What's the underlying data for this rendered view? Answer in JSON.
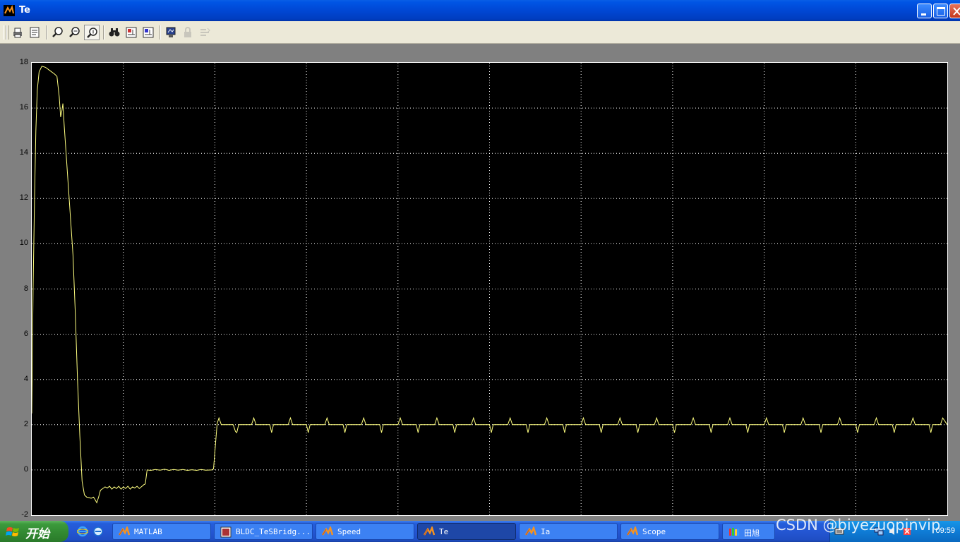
{
  "window": {
    "title": "Te"
  },
  "toolbar": {
    "buttons": [
      {
        "name": "print-button",
        "icon": "printer-icon"
      },
      {
        "name": "parameters-button",
        "icon": "parameters-icon"
      },
      {
        "name": "zoom-button",
        "icon": "magnifier-icon"
      },
      {
        "name": "zoom-x-button",
        "icon": "magnifier-x-icon"
      },
      {
        "name": "zoom-y-button",
        "icon": "magnifier-y-icon",
        "pressed": true
      },
      {
        "name": "autoscale-button",
        "icon": "binoculars-icon"
      },
      {
        "name": "save-axes-button",
        "icon": "save-axes-icon"
      },
      {
        "name": "restore-axes-button",
        "icon": "restore-axes-icon"
      },
      {
        "name": "floating-scope-button",
        "icon": "scope-icon"
      },
      {
        "name": "lock-axes-button",
        "icon": "lock-icon",
        "disabled": true
      },
      {
        "name": "signal-selection-button",
        "icon": "signal-selection-icon",
        "disabled": true
      }
    ]
  },
  "chart_data": {
    "type": "line",
    "title": "",
    "xlabel": "",
    "ylabel": "",
    "ylim": [
      -2,
      18
    ],
    "yticks": [
      "18",
      "16",
      "14",
      "12",
      "10",
      "8",
      "6",
      "4",
      "2",
      "0",
      "-2"
    ],
    "xlim": [
      0,
      0.2
    ],
    "grid": true,
    "line_color": "#ffff80",
    "background": "#000000",
    "series": [
      {
        "points": [
          [
            0,
            2.5
          ],
          [
            0.0003,
            8
          ],
          [
            0.0006,
            12
          ],
          [
            0.0009,
            15
          ],
          [
            0.0012,
            16.8
          ],
          [
            0.0016,
            17.6
          ],
          [
            0.0022,
            17.85
          ],
          [
            0.003,
            17.8
          ],
          [
            0.004,
            17.65
          ],
          [
            0.005,
            17.5
          ],
          [
            0.0055,
            17.4
          ],
          [
            0.006,
            16.5
          ],
          [
            0.0063,
            15.6
          ],
          [
            0.0066,
            15.9
          ],
          [
            0.0068,
            16.2
          ],
          [
            0.0071,
            15.2
          ],
          [
            0.008,
            12.5
          ],
          [
            0.009,
            9.5
          ],
          [
            0.0095,
            7
          ],
          [
            0.01,
            4
          ],
          [
            0.0105,
            1.5
          ],
          [
            0.011,
            -0.5
          ],
          [
            0.0115,
            -1.1
          ],
          [
            0.012,
            -1.2
          ],
          [
            0.013,
            -1.25
          ],
          [
            0.0135,
            -1.2
          ],
          [
            0.0138,
            -1.3
          ],
          [
            0.0142,
            -1.45
          ],
          [
            0.0146,
            -1.2
          ],
          [
            0.015,
            -0.9
          ],
          [
            0.016,
            -0.75
          ],
          [
            0.0165,
            -0.8
          ],
          [
            0.017,
            -0.72
          ],
          [
            0.0175,
            -0.85
          ],
          [
            0.018,
            -0.75
          ],
          [
            0.0185,
            -0.82
          ],
          [
            0.019,
            -0.72
          ],
          [
            0.0195,
            -0.85
          ],
          [
            0.02,
            -0.75
          ],
          [
            0.0205,
            -0.82
          ],
          [
            0.021,
            -0.72
          ],
          [
            0.0215,
            -0.85
          ],
          [
            0.022,
            -0.75
          ],
          [
            0.0225,
            -0.8
          ],
          [
            0.023,
            -0.72
          ],
          [
            0.0235,
            -0.82
          ],
          [
            0.0245,
            -0.65
          ],
          [
            0.0248,
            -0.62
          ],
          [
            0.0252,
            0
          ],
          [
            0.026,
            -0.02
          ],
          [
            0.027,
            0.02
          ],
          [
            0.028,
            -0.01
          ],
          [
            0.029,
            0.03
          ],
          [
            0.03,
            -0.02
          ],
          [
            0.031,
            0.02
          ],
          [
            0.032,
            -0.01
          ],
          [
            0.033,
            0.02
          ],
          [
            0.034,
            -0.02
          ],
          [
            0.035,
            0.01
          ],
          [
            0.036,
            -0.02
          ],
          [
            0.037,
            0.02
          ],
          [
            0.038,
            -0.01
          ],
          [
            0.0393,
            0
          ],
          [
            0.0397,
            0.05
          ],
          [
            0.0405,
            2.05
          ],
          [
            0.0409,
            2.3
          ],
          [
            0.0414,
            2.0
          ],
          [
            0.044,
            2.0
          ],
          [
            0.0445,
            1.7
          ],
          [
            0.0448,
            1.65
          ],
          [
            0.0452,
            2.0
          ],
          [
            0.048,
            2.0
          ],
          [
            0.0485,
            2.3
          ],
          [
            0.049,
            2.0
          ],
          [
            0.052,
            2.0
          ],
          [
            0.0524,
            1.65
          ],
          [
            0.0528,
            2.0
          ],
          [
            0.056,
            2.0
          ],
          [
            0.0565,
            2.3
          ],
          [
            0.057,
            2.0
          ],
          [
            0.06,
            2.0
          ],
          [
            0.0604,
            1.65
          ],
          [
            0.0608,
            2.0
          ],
          [
            0.064,
            2.0
          ],
          [
            0.0645,
            2.3
          ],
          [
            0.065,
            2.0
          ],
          [
            0.068,
            2.0
          ],
          [
            0.0684,
            1.65
          ],
          [
            0.0688,
            2.0
          ],
          [
            0.072,
            2.0
          ],
          [
            0.0725,
            2.3
          ],
          [
            0.073,
            2.0
          ],
          [
            0.076,
            2.0
          ],
          [
            0.0764,
            1.65
          ],
          [
            0.0768,
            2.0
          ],
          [
            0.08,
            2.0
          ],
          [
            0.0805,
            2.3
          ],
          [
            0.081,
            2.0
          ],
          [
            0.084,
            2.0
          ],
          [
            0.0844,
            1.65
          ],
          [
            0.0848,
            2.0
          ],
          [
            0.088,
            2.0
          ],
          [
            0.0885,
            2.3
          ],
          [
            0.089,
            2.0
          ],
          [
            0.092,
            2.0
          ],
          [
            0.0924,
            1.65
          ],
          [
            0.0928,
            2.0
          ],
          [
            0.096,
            2.0
          ],
          [
            0.0965,
            2.3
          ],
          [
            0.097,
            2.0
          ],
          [
            0.1,
            2.0
          ],
          [
            0.1004,
            1.65
          ],
          [
            0.1008,
            2.0
          ],
          [
            0.104,
            2.0
          ],
          [
            0.1045,
            2.3
          ],
          [
            0.105,
            2.0
          ],
          [
            0.108,
            2.0
          ],
          [
            0.1084,
            1.65
          ],
          [
            0.1088,
            2.0
          ],
          [
            0.112,
            2.0
          ],
          [
            0.1125,
            2.3
          ],
          [
            0.113,
            2.0
          ],
          [
            0.116,
            2.0
          ],
          [
            0.1164,
            1.65
          ],
          [
            0.1168,
            2.0
          ],
          [
            0.12,
            2.0
          ],
          [
            0.1205,
            2.3
          ],
          [
            0.121,
            2.0
          ],
          [
            0.124,
            2.0
          ],
          [
            0.1244,
            1.65
          ],
          [
            0.1248,
            2.0
          ],
          [
            0.128,
            2.0
          ],
          [
            0.1285,
            2.3
          ],
          [
            0.129,
            2.0
          ],
          [
            0.132,
            2.0
          ],
          [
            0.1324,
            1.65
          ],
          [
            0.1328,
            2.0
          ],
          [
            0.136,
            2.0
          ],
          [
            0.1365,
            2.3
          ],
          [
            0.137,
            2.0
          ],
          [
            0.14,
            2.0
          ],
          [
            0.1404,
            1.65
          ],
          [
            0.1408,
            2.0
          ],
          [
            0.144,
            2.0
          ],
          [
            0.1445,
            2.3
          ],
          [
            0.145,
            2.0
          ],
          [
            0.148,
            2.0
          ],
          [
            0.1484,
            1.65
          ],
          [
            0.1488,
            2.0
          ],
          [
            0.152,
            2.0
          ],
          [
            0.1525,
            2.3
          ],
          [
            0.153,
            2.0
          ],
          [
            0.156,
            2.0
          ],
          [
            0.1564,
            1.65
          ],
          [
            0.1568,
            2.0
          ],
          [
            0.16,
            2.0
          ],
          [
            0.1605,
            2.3
          ],
          [
            0.161,
            2.0
          ],
          [
            0.164,
            2.0
          ],
          [
            0.1644,
            1.65
          ],
          [
            0.1648,
            2.0
          ],
          [
            0.168,
            2.0
          ],
          [
            0.1685,
            2.3
          ],
          [
            0.169,
            2.0
          ],
          [
            0.172,
            2.0
          ],
          [
            0.1724,
            1.65
          ],
          [
            0.1728,
            2.0
          ],
          [
            0.176,
            2.0
          ],
          [
            0.1765,
            2.3
          ],
          [
            0.177,
            2.0
          ],
          [
            0.18,
            2.0
          ],
          [
            0.1804,
            1.65
          ],
          [
            0.1808,
            2.0
          ],
          [
            0.184,
            2.0
          ],
          [
            0.1845,
            2.3
          ],
          [
            0.185,
            2.0
          ],
          [
            0.188,
            2.0
          ],
          [
            0.1884,
            1.65
          ],
          [
            0.1888,
            2.0
          ],
          [
            0.192,
            2.0
          ],
          [
            0.1925,
            2.3
          ],
          [
            0.193,
            2.0
          ],
          [
            0.196,
            2.0
          ],
          [
            0.1964,
            1.65
          ],
          [
            0.1968,
            2.0
          ],
          [
            0.1985,
            2.0
          ],
          [
            0.199,
            2.3
          ],
          [
            0.2,
            2.0
          ]
        ]
      }
    ]
  },
  "taskbar": {
    "start_label": "开始",
    "quicklaunch": [
      "ie-icon",
      "ie-alt-icon"
    ],
    "tasks": [
      {
        "label": "MATLAB",
        "icon": "matlab-icon",
        "active": false
      },
      {
        "label": "BLDC_TeSBridg...",
        "icon": "simulink-icon",
        "active": false
      },
      {
        "label": "Speed",
        "icon": "matlab-icon",
        "active": false
      },
      {
        "label": "Te",
        "icon": "matlab-icon",
        "active": true
      },
      {
        "label": "Ia",
        "icon": "matlab-icon",
        "active": false
      },
      {
        "label": "Scope",
        "icon": "matlab-icon",
        "active": false
      },
      {
        "label": "田旭",
        "icon": "chat-icon",
        "active": false
      }
    ],
    "clock": "09:59"
  },
  "watermark": "CSDN @biyezuopinvip"
}
